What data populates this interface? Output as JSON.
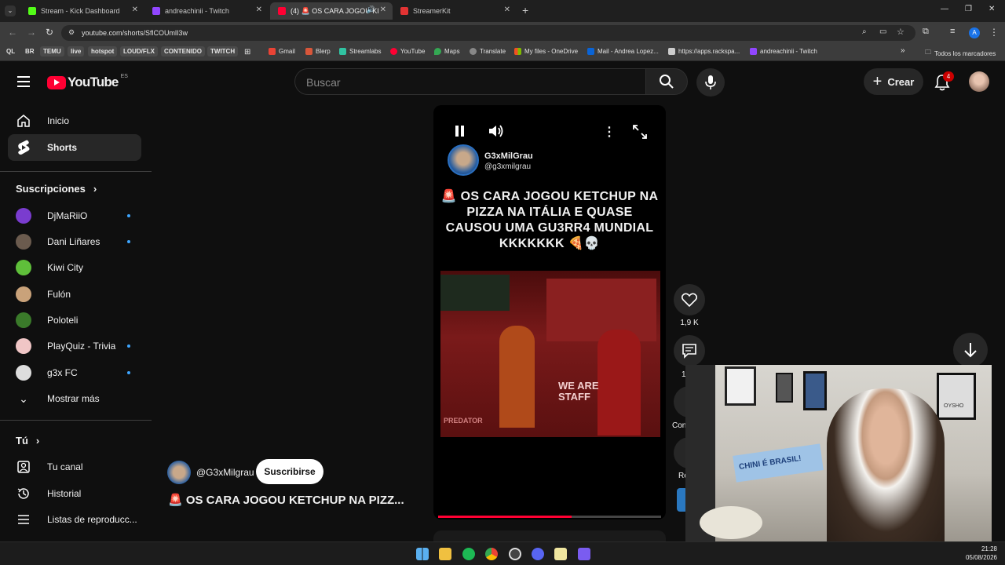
{
  "browser": {
    "tabs": [
      {
        "label": "Stream - Kick Dashboard",
        "color": "#53fc18"
      },
      {
        "label": "andreachinii - Twitch",
        "color": "#9146ff"
      },
      {
        "label": "(4) 🚨 OS CARA JOGOU KI",
        "color": "#ff0033"
      },
      {
        "label": "StreamerKit",
        "color": "#e23333"
      }
    ],
    "new_tab": "+",
    "url": "youtube.com/shorts/SflCOUmlI3w",
    "profile_initial": "A",
    "bookmarks": {
      "tags": [
        "QL",
        "BR",
        "TEMU",
        "live",
        "hotspot",
        "LOUD/FLX",
        "CONTENIDO",
        "TWITCH"
      ],
      "links": [
        "Gmail",
        "Blerp",
        "Streamlabs",
        "YouTube",
        "Maps",
        "Translate",
        "My files - OneDrive",
        "Mail - Andrea Lopez...",
        "https://apps.rackspa...",
        "andreachinii - Twitch"
      ],
      "more": "»",
      "all": "Todos los marcadores"
    }
  },
  "youtube": {
    "logo_text": "YouTube",
    "region": "ES",
    "search_placeholder": "Buscar",
    "create_label": "Crear",
    "notification_count": "4"
  },
  "sidebar": {
    "main": [
      {
        "label": "Inicio",
        "icon": "home-icon"
      },
      {
        "label": "Shorts",
        "icon": "shorts-icon"
      }
    ],
    "subs_title": "Suscripciones",
    "subscriptions": [
      {
        "label": "DjMaRiiO",
        "color": "#7a3ccf",
        "dot": true
      },
      {
        "label": "Dani Liñares",
        "color": "#6b5b4e",
        "dot": true
      },
      {
        "label": "Kiwi City",
        "color": "#5fbf3a",
        "dot": false
      },
      {
        "label": "Fulón",
        "color": "#c9a27a",
        "dot": false
      },
      {
        "label": "Poloteli",
        "color": "#3a7a2a",
        "dot": false
      },
      {
        "label": "PlayQuiz - Trivia",
        "color": "#f0c6c6",
        "dot": true
      },
      {
        "label": "g3x FC",
        "color": "#dddddd",
        "dot": true
      }
    ],
    "show_more": "Mostrar más",
    "you_title": "Tú",
    "you_items": [
      {
        "label": "Tu canal"
      },
      {
        "label": "Historial"
      },
      {
        "label": "Listas de reproducc..."
      }
    ]
  },
  "short": {
    "channel_name": "G3xMilGrau",
    "channel_handle": "@g3xmilgrau",
    "title_overlay": "🚨 OS CARA JOGOU KETCHUP NA PIZZA NA ITÁLIA E QUASE CAUSOU UMA GU3RR4 MUNDIAL KKKKKKK 🍕💀",
    "video_caption": "WE ARE STAFF",
    "video_caption2": "PREDATOR",
    "progress": 0.6,
    "likes": "1,9 K",
    "comments_label": "1",
    "action3_label": "Con",
    "action4_label": "Re",
    "bottom_channel": "@G3xMilgrau",
    "subscribe_label": "Suscribirse",
    "bottom_title": "🚨 OS CARA JOGOU KETCHUP NA PIZZ..."
  },
  "webcam": {
    "banner_text": "CHINI É BRASIL!",
    "poster_text": "OYSHO"
  },
  "taskbar": {
    "time": "21:28",
    "date": "05/08/2026"
  }
}
